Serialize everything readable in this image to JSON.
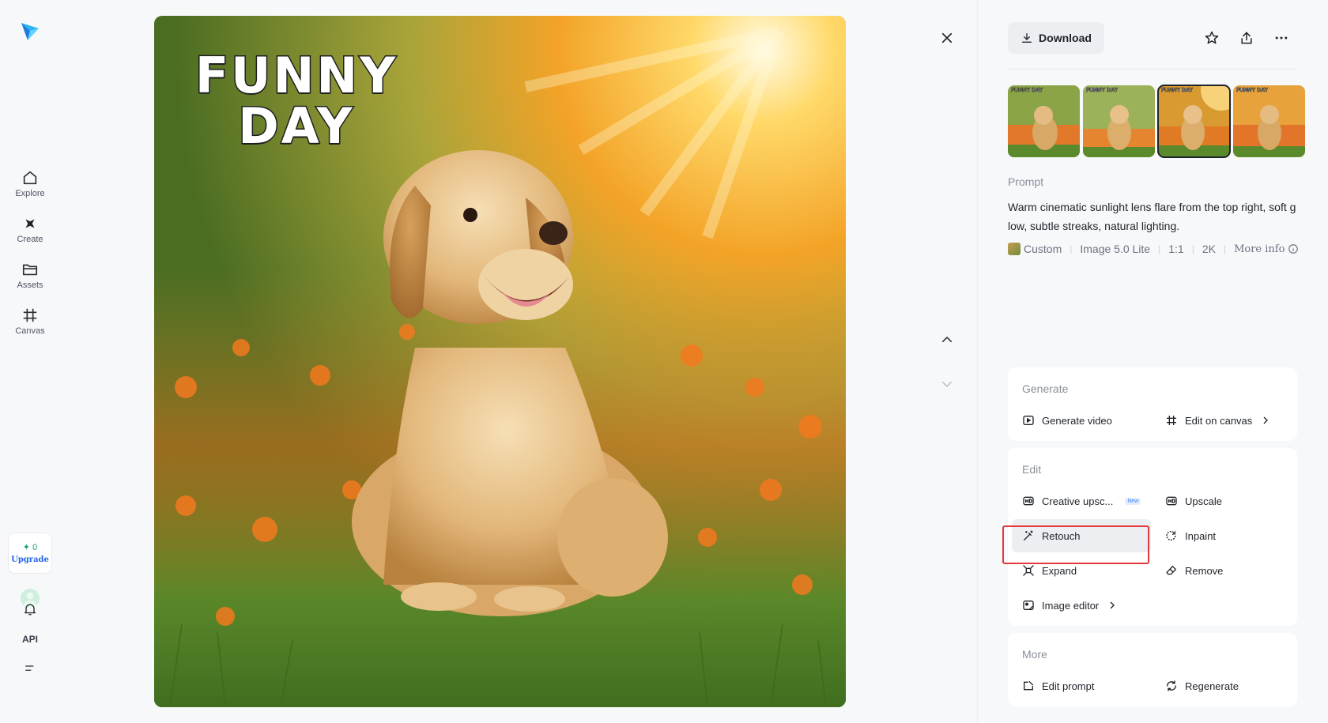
{
  "rail": {
    "nav": [
      {
        "label": "Explore",
        "icon": "home-icon"
      },
      {
        "label": "Create",
        "icon": "sparkle-icon"
      },
      {
        "label": "Assets",
        "icon": "folder-icon"
      },
      {
        "label": "Canvas",
        "icon": "canvas-icon"
      }
    ],
    "credits": {
      "count": "0",
      "upgrade_label": "Upgrade"
    },
    "api_label": "API"
  },
  "image": {
    "overlay_line1": "FUNNY",
    "overlay_line2": "DAY"
  },
  "toolbar": {
    "download_label": "Download"
  },
  "thumbnails": {
    "overlay_text": "FUNNY DAY",
    "selected_index": 2,
    "count": 4
  },
  "prompt": {
    "label": "Prompt",
    "text": "Warm cinematic sunlight lens flare from the top right, soft glow, subtle streaks, natural lighting."
  },
  "meta": {
    "style": "Custom",
    "model": "Image 5.0 Lite",
    "ratio": "1:1",
    "resolution": "2K",
    "more_info": "More info"
  },
  "generate": {
    "title": "Generate",
    "video_label": "Generate video",
    "canvas_label": "Edit on canvas"
  },
  "edit": {
    "title": "Edit",
    "creative_upscale": "Creative upsc...",
    "new_badge": "New",
    "upscale": "Upscale",
    "retouch": "Retouch",
    "inpaint": "Inpaint",
    "expand": "Expand",
    "remove": "Remove",
    "image_editor": "Image editor"
  },
  "more": {
    "title": "More",
    "edit_prompt": "Edit prompt",
    "regenerate": "Regenerate"
  },
  "colors": {
    "highlight": "#e4393c",
    "accent_blue": "#2563eb",
    "credit_green": "#1e9e6a"
  }
}
